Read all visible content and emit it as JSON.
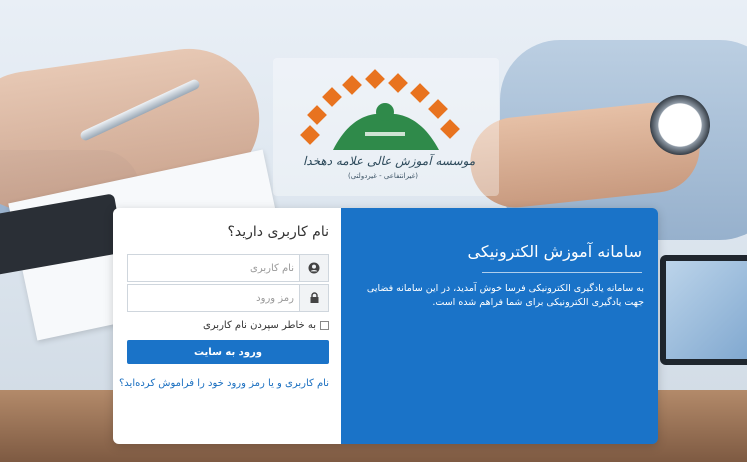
{
  "branding": {
    "institute_name": "موسسه آموزش عالی علامه دهخدا",
    "institute_subtitle": "(غیرانتفاعی - غیردولتی)"
  },
  "login": {
    "heading": "نام کاربری دارید؟",
    "username_placeholder": "نام کاربری",
    "password_placeholder": "رمز ورود",
    "remember_label": "به خاطر سپردن نام کاربری",
    "submit_label": "ورود به سایت",
    "forgot_link": "نام کاربری و یا رمز ورود خود را فراموش کرده‌اید؟"
  },
  "info": {
    "title": "سامانه آموزش الکترونیکی",
    "welcome_text": "به سامانه یادگیری الکترونیکی فرسا خوش آمدید، در این سامانه فضایی جهت یادگیری الکترونیکی برای شما فراهم شده است."
  },
  "icons": {
    "username": "user-icon",
    "password": "lock-icon"
  },
  "colors": {
    "accent": "#1a73c8",
    "logo_orange": "#e8731f",
    "logo_green": "#2f8a4a"
  }
}
